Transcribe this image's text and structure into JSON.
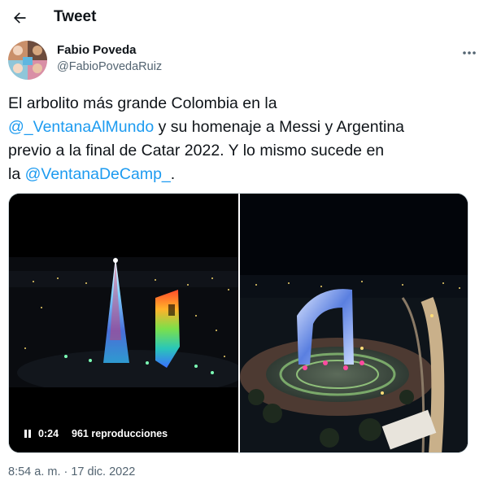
{
  "header": {
    "title": "Tweet",
    "back_icon": "arrow-left-icon"
  },
  "author": {
    "name": "Fabio Poveda",
    "handle": "@FabioPovedaRuiz",
    "more_icon": "more-dots-icon"
  },
  "tweet": {
    "line1": "El arbolito más grande Colombia en la",
    "mention1": "@_VentanaAlMundo",
    "line2_rest": " y su homenaje a Messi y Argentina",
    "line3": "previo a la final de Catar 2022. Y lo mismo sucede en",
    "line4_prefix": "la ",
    "mention2": "@VentanaDeCamp_",
    "line4_suffix": "."
  },
  "video": {
    "time": "0:24",
    "views": "961 reproducciones",
    "pause_icon": "pause-icon"
  },
  "meta": {
    "timestamp": "8:54 a. m. · 17 dic. 2022"
  },
  "colors": {
    "link": "#1d9bf0",
    "secondary": "#536471",
    "text": "#0f1419"
  }
}
